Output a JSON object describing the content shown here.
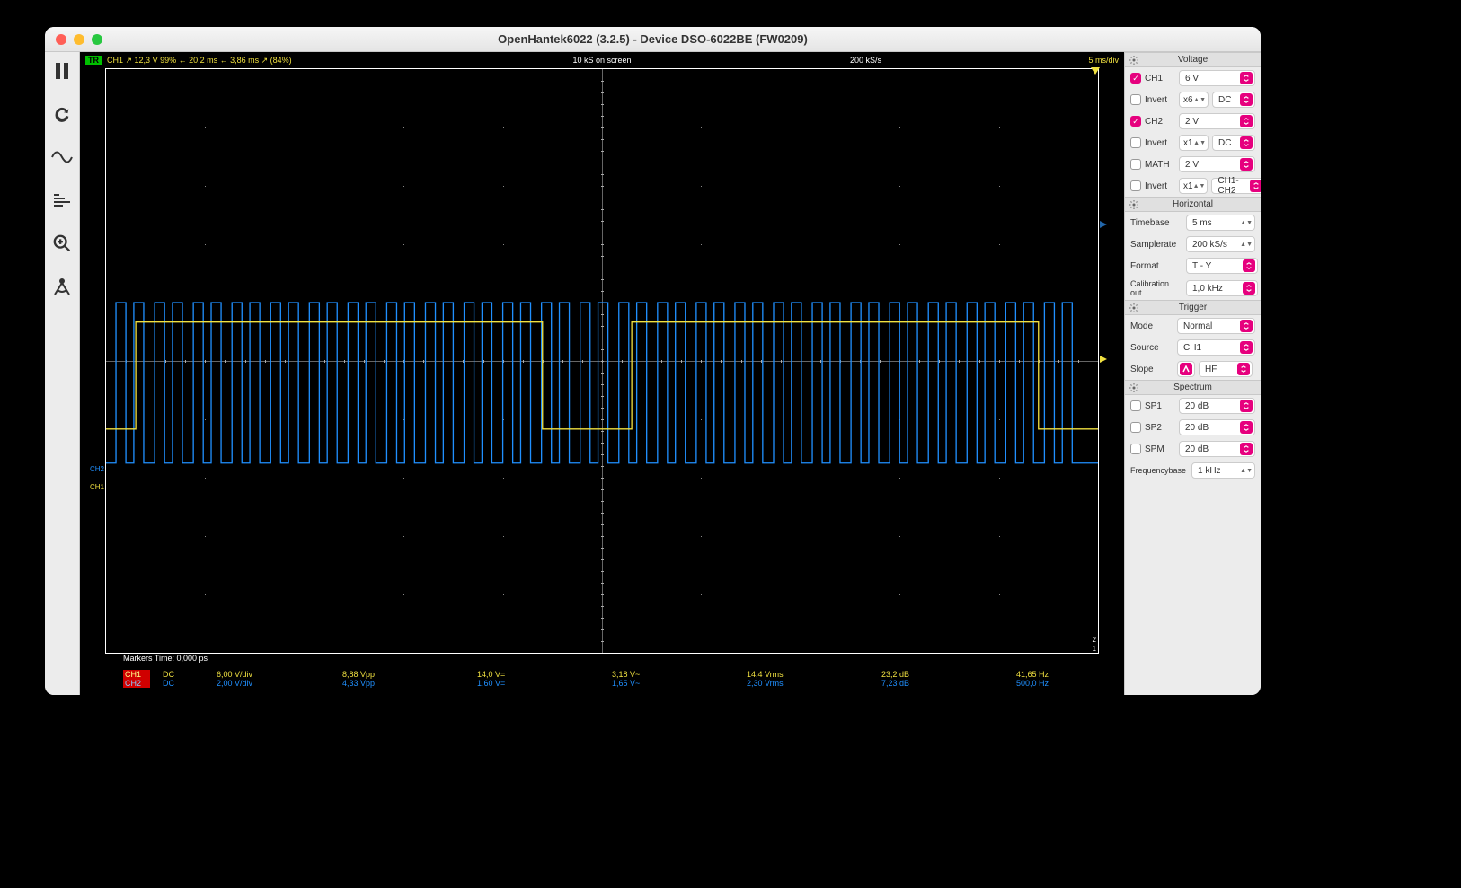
{
  "title": "OpenHantek6022 (3.2.5) - Device DSO-6022BE (FW0209)",
  "topline": {
    "tr": "TR",
    "info": "CH1  ↗ 12,3 V  99%  ← 20,2 ms ← 3,86 ms ↗ (84%)",
    "center": "10 kS on screen",
    "ks": "200 kS/s",
    "right": "5 ms/div"
  },
  "markers_line": "Markers  Time: 0,000 ps",
  "measure": {
    "ch1": {
      "name": "CH1",
      "coupling": "DC",
      "vdiv": "6,00 V/div",
      "vpp": "8,88 Vpp",
      "veq": "14,0 V=",
      "vmin": "3,18 V~",
      "vrms": "14,4 Vrms",
      "db": "23,2 dB",
      "freq": "41,65 Hz"
    },
    "ch2": {
      "name": "CH2",
      "coupling": "DC",
      "vdiv": "2,00 V/div",
      "vpp": "4,33 Vpp",
      "veq": "1,60 V=",
      "vmin": "1,65 V~",
      "vrms": "2,30 Vrms",
      "db": "7,23 dB",
      "freq": "500,0 Hz"
    }
  },
  "ch_labels": {
    "ch1": "CH1",
    "ch2": "CH2"
  },
  "side": {
    "voltage": {
      "head": "Voltage",
      "ch1": {
        "label": "CH1",
        "range": "6 V"
      },
      "ch1_invert": {
        "label": "Invert",
        "probe": "x6",
        "coupling": "DC"
      },
      "ch2": {
        "label": "CH2",
        "range": "2 V"
      },
      "ch2_invert": {
        "label": "Invert",
        "probe": "x1",
        "coupling": "DC"
      },
      "math": {
        "label": "MATH",
        "range": "2 V"
      },
      "math_invert": {
        "label": "Invert",
        "probe": "x1",
        "coupling": "CH1-CH2"
      }
    },
    "horizontal": {
      "head": "Horizontal",
      "timebase": {
        "label": "Timebase",
        "value": "5 ms"
      },
      "samplerate": {
        "label": "Samplerate",
        "value": "200 kS/s"
      },
      "format": {
        "label": "Format",
        "value": "T - Y"
      },
      "calibration": {
        "label": "Calibration out",
        "value": "1,0 kHz"
      }
    },
    "trigger": {
      "head": "Trigger",
      "mode": {
        "label": "Mode",
        "value": "Normal"
      },
      "source": {
        "label": "Source",
        "value": "CH1"
      },
      "slope": {
        "label": "Slope",
        "value": "HF"
      }
    },
    "spectrum": {
      "head": "Spectrum",
      "sp1": {
        "label": "SP1",
        "value": "20 dB"
      },
      "sp2": {
        "label": "SP2",
        "value": "20 dB"
      },
      "spm": {
        "label": "SPM",
        "value": "20 dB"
      },
      "freqbase": {
        "label": "Frequencybase",
        "value": "1 kHz"
      }
    }
  }
}
